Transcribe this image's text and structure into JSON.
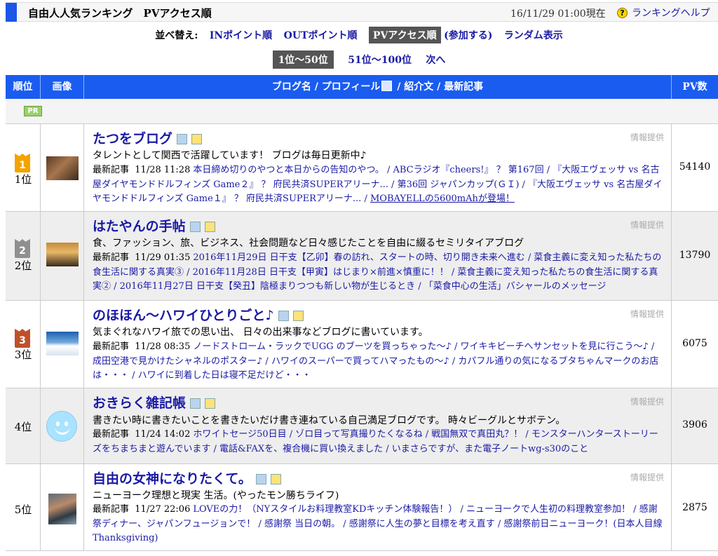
{
  "header": {
    "title": "自由人人気ランキング　PVアクセス順",
    "date": "16/11/29 01:00現在",
    "help_icon": "?",
    "help_label": "ランキングヘルプ"
  },
  "sort": {
    "label": "並べ替え:",
    "in_points": "INポイント順",
    "out_points": "OUTポイント順",
    "pv_access": "PVアクセス順",
    "join": "(参加する)",
    "random": "ランダム表示"
  },
  "pager": {
    "current": "1位〜50位",
    "next_range": "51位〜100位",
    "next": "次へ"
  },
  "table": {
    "col_rank": "順位",
    "col_image": "画像",
    "col_blog_a": "ブログ名 / プロフィール",
    "col_blog_b": " / 紹介文 / 最新記事",
    "col_pv": "PV数"
  },
  "pr_label": "PR",
  "info_label": "情報提供",
  "latest_label": "最新記事",
  "rows": [
    {
      "rank_num": "1",
      "rank": "1位",
      "title": "たつをブログ",
      "desc": "タレントとして関西で活躍しています！ ブログは毎日更新中♪",
      "timestamp": "11/28 11:28",
      "posts": "本日締め切りのやつと本日からの告知のやつ。 / ABCラジオ『cheers!』 ？ 第167回 / 『大阪エヴェッサ vs 名古屋ダイヤモンドドルフィンズ Game２』 ？ 府民共済SUPERアリーナ... / 第36回 ジャパンカップ(ＧＩ) / 『大阪エヴェッサ vs 名古屋ダイヤモンドドルフィンズ Game１』 ？ 府民共済SUPERアリーナ... / ",
      "posts_last": "MOBAYELLの5600mAhが登場！",
      "pv": "54140"
    },
    {
      "rank_num": "2",
      "rank": "2位",
      "title": "はたやんの手帖",
      "desc": "食、ファッション、旅、ビジネス、社会問題など日々感じたことを自由に綴るセミリタイアブログ",
      "timestamp": "11/29 01:35",
      "posts": "2016年11月29日 日干支【乙卯】春の訪れ、スタートの時、切り開き未来へ進む / 菜食主義に変え知った私たちの食生活に関する真実③ / 2016年11月28日 日干支【甲寅】はじまり×前進×慎重に！！ / 菜食主義に変え知った私たちの食生活に関する真実② / 2016年11月27日 日干支【癸丑】陰極まりつつも新しい物が生じるとき / 「菜食中心の生活」バシャールのメッセージ",
      "posts_last": "",
      "pv": "13790"
    },
    {
      "rank_num": "3",
      "rank": "3位",
      "title": "のほほん〜ハワイひとりごと♪",
      "desc": "気まぐれなハワイ旅での思い出、 日々の出来事などブログに書いています。",
      "timestamp": "11/28 08:35",
      "posts": "ノードストローム・ラックでUGG のブーツを買っちゃった〜♪ / ワイキキビーチへサンセットを見に行こう〜♪ / 成田空港で見かけたシャネルのポスター♪ / ハワイのスーパーで買ってハマったもの〜♪ / カパフル通りの気になるブタちゃんマークのお店は・・・ / ハワイに到着した日は寝不足だけど・・・",
      "posts_last": "",
      "pv": "6075"
    },
    {
      "rank_num": "",
      "rank": "4位",
      "title": "おきらく雑記帳",
      "desc": "書きたい時に書きたいことを書きたいだけ書き連ねている自己満足ブログです。 時々ビーグルとサボテン。",
      "timestamp": "11/24 14:02",
      "posts": "ホワイトセージ50日目 / ゾロ目って写真撮りたくなるね / 戦国無双で真田丸？！ / モンスターハンターストーリーズをちまちまと遊んでいます / 電話&FAXを、複合機に買い換えました / いまさらですが、また電子ノートwg-s30のこと",
      "posts_last": "",
      "pv": "3906"
    },
    {
      "rank_num": "",
      "rank": "5位",
      "title": "自由の女神になりたくて。",
      "desc": "ニューヨーク理想と現実 生活。(やったモン勝ちライフ)",
      "timestamp": "11/27 22:06",
      "posts": "LOVEの力！（NYスタイルお料理教室KDキッチン体験報告！） / ニューヨークで人生初の料理教室参加！ / 感謝祭ディナー、ジャパンフュージョンで！ / 感謝祭 当日の朝。 / 感謝祭に人生の夢と目標を考え直す / 感謝祭前日ニューヨーク！(日本人目線Thanksgiving)",
      "posts_last": "",
      "pv": "2875"
    }
  ]
}
